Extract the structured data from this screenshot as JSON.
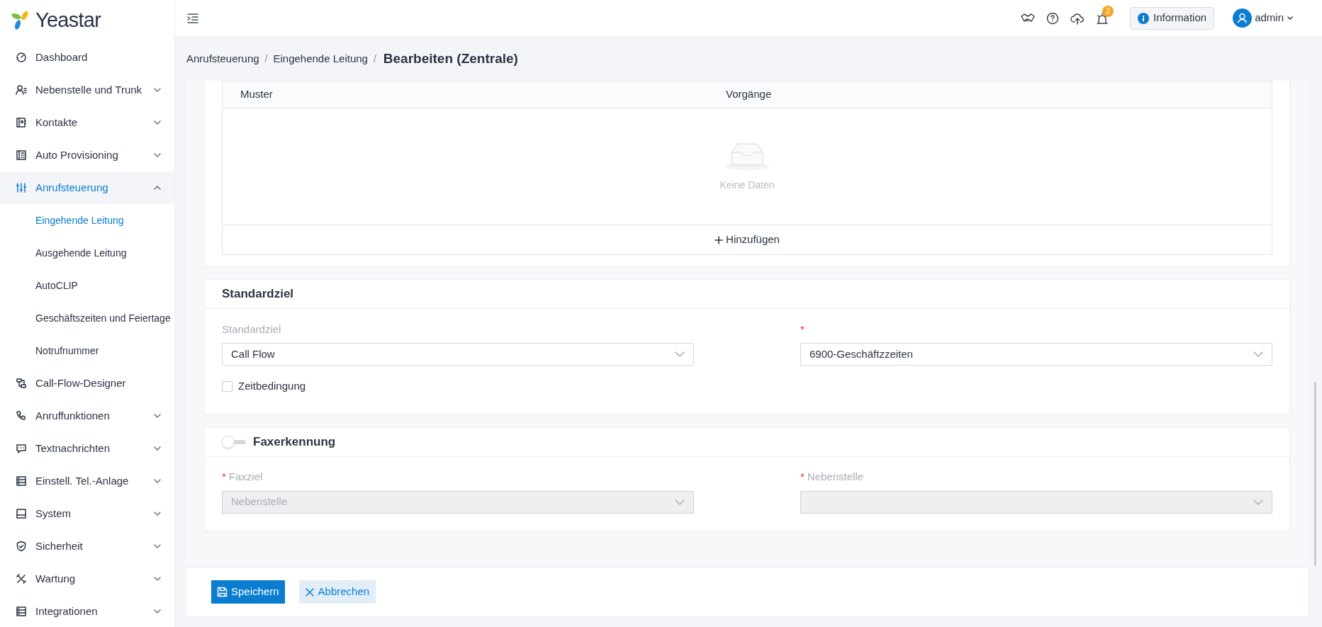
{
  "logo": {
    "text": "Yeastar"
  },
  "sidebar": {
    "items": [
      {
        "label": "Dashboard",
        "selected": false
      },
      {
        "label": "Nebenstelle und Trunk",
        "expanded": false,
        "selected": false
      },
      {
        "label": "Kontakte",
        "expanded": false,
        "selected": false
      },
      {
        "label": "Auto Provisioning",
        "expanded": false,
        "selected": false
      },
      {
        "label": "Anrufsteuerung",
        "expanded": true,
        "selected": true,
        "children": [
          {
            "label": "Eingehende Leitung",
            "selected": true
          },
          {
            "label": "Ausgehende Leitung",
            "selected": false
          },
          {
            "label": "AutoCLIP",
            "selected": false
          },
          {
            "label": "Geschäftszeiten und Feiertage",
            "selected": false
          },
          {
            "label": "Notrufnummer",
            "selected": false
          }
        ]
      },
      {
        "label": "Call-Flow-Designer",
        "selected": false
      },
      {
        "label": "Anruffunktionen",
        "expanded": false,
        "selected": false
      },
      {
        "label": "Textnachrichten",
        "expanded": false,
        "selected": false
      },
      {
        "label": "Einstell. Tel.-Anlage",
        "expanded": false,
        "selected": false
      },
      {
        "label": "System",
        "expanded": false,
        "selected": false
      },
      {
        "label": "Sicherheit",
        "expanded": false,
        "selected": false
      },
      {
        "label": "Wartung",
        "expanded": false,
        "selected": false
      },
      {
        "label": "Integrationen",
        "expanded": false,
        "selected": false
      }
    ]
  },
  "top_bar": {
    "notification_count": "2",
    "info_button": "Information",
    "user": "admin"
  },
  "breadcrumb": [
    {
      "label": "Anrufsteuerung",
      "separator": "/"
    },
    {
      "label": "Eingehende Leitung",
      "separator": "/"
    }
  ],
  "page_title": "Bearbeiten (Zentrale)",
  "pattern_table": {
    "columns": [
      "Muster",
      "Vorgänge"
    ],
    "empty_text": "Keine Daten",
    "add_button": "Hinzufügen"
  },
  "default_destination": {
    "title": "Standardziel",
    "fields": [
      {
        "label": "Standardziel",
        "value": "Call Flow",
        "disabled": false
      },
      {
        "required_mark": "*",
        "value": "6900-Geschäftzzeiten",
        "disabled": false
      }
    ],
    "time_condition": {
      "label": "Zeitbedingung",
      "checked": false
    }
  },
  "fax_detection": {
    "title": "Faxerkennung",
    "on": false,
    "fields": [
      {
        "label": "Faxziel",
        "required_mark": "*",
        "value": "Nebenstelle",
        "disabled": true
      },
      {
        "label": "Nebenstelle",
        "required_mark": "*",
        "disabled": true
      }
    ]
  },
  "footer": {
    "save": "Speichern",
    "cancel": "Abbrechen"
  }
}
